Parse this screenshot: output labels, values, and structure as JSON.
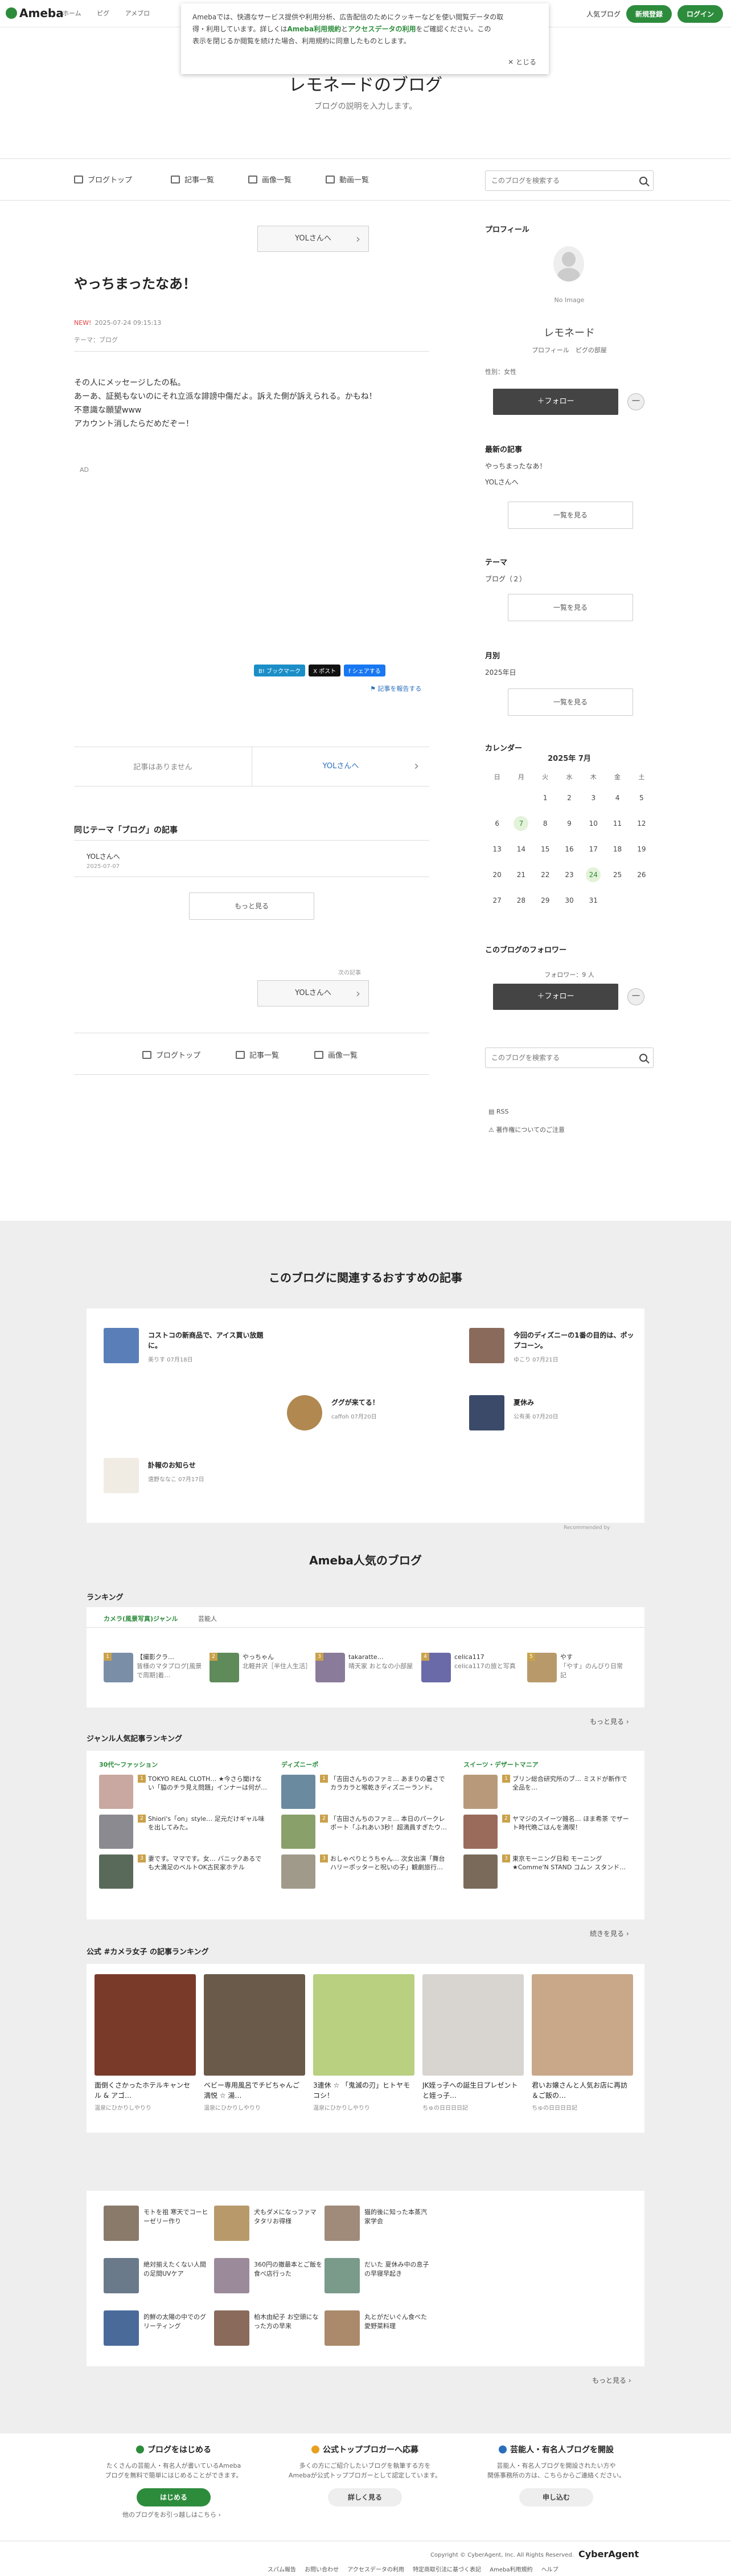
{
  "header": {
    "logo": "Ameba",
    "crumbs": [
      "ホーム",
      "ピグ",
      "アメブロ"
    ],
    "popular": "人気ブログ",
    "signup": "新規登録",
    "login": "ログイン"
  },
  "cookie": {
    "line1": "Amebaでは、快適なサービス提供や利用分析、広告配信のためにクッキーなどを使い閲覧データの取",
    "line2a": "得・利用しています。詳しくは",
    "terms": "Ameba利用規約",
    "and": "と",
    "policy": "アクセスデータの利用",
    "line2b": "をご確認ください。この",
    "line3": "表示を閉じるか閲覧を続けた場合、利用規約に同意したものとします。",
    "close": "とじる"
  },
  "blog": {
    "title": "レモネードのブログ",
    "description": "ブログの説明を入力します。"
  },
  "nav": {
    "top": "ブログトップ",
    "entries": "記事一覧",
    "images": "画像一覧",
    "videos": "動画一覧",
    "search_placeholder": "このブログを検索する"
  },
  "entry": {
    "next_label": "YOLさんへ",
    "title": "やっちまったなあ！",
    "new_badge": "NEW!",
    "datetime": "2025-07-24 09:15:13",
    "theme": "テーマ：ブログ",
    "body": [
      "その人にメッセージしたの私。",
      "あーあ、証拠もないのにそれ立派な誹謗中傷だよ。訴えた側が訴えられる。かもね！",
      "不意識な願望www",
      "アカウント消したらだめだぞー！"
    ],
    "ad": "AD",
    "share": {
      "hatena": "B! ブックマーク",
      "x": "X ポスト",
      "facebook": "f シェアする"
    },
    "report": "記事を報告する",
    "prev_none": "記事はありません",
    "next_title": "YOLさんへ",
    "same_theme_heading": "同じテーマ「ブログ」の記事",
    "same_item_title": "YOLさんへ",
    "same_item_date": "2025-07-07",
    "more": "もっと見る",
    "prev_label": "次の記事",
    "prev_button": "YOLさんへ"
  },
  "sidebar": {
    "profile_heading": "プロフィール",
    "noimage": "No Image",
    "name": "レモネード",
    "link_profile": "プロフィール",
    "link_room": "ピグの部屋",
    "gender": "性別：女性",
    "follow": "＋フォロー",
    "minus": "ー",
    "recent_heading": "最新の記事",
    "recent": [
      "やっちまったなあ！",
      "YOLさんへ"
    ],
    "recent_more": "一覧を見る",
    "theme_heading": "テーマ",
    "theme_item": "ブログ（２）",
    "theme_more": "一覧を見る",
    "monthly_heading": "月別",
    "monthly_item": "2025年日",
    "monthly_more": "一覧を見る",
    "calendar_heading": "カレンダー",
    "calendar_title": "2025年 7月",
    "weekdays": [
      "日",
      "月",
      "火",
      "水",
      "木",
      "金",
      "土"
    ],
    "weeks": [
      [
        "",
        "",
        "1",
        "2",
        "3",
        "4",
        "5"
      ],
      [
        "6",
        "7",
        "8",
        "9",
        "10",
        "11",
        "12"
      ],
      [
        "13",
        "14",
        "15",
        "16",
        "17",
        "18",
        "19"
      ],
      [
        "20",
        "21",
        "22",
        "23",
        "24",
        "25",
        "26"
      ],
      [
        "27",
        "28",
        "29",
        "30",
        "31",
        "",
        ""
      ]
    ],
    "follower_heading": "このブログのフォロワー",
    "follower_count": "フォロワー：9 人",
    "follow2": "＋フォロー",
    "search_placeholder": "このブログを検索する",
    "rss": "RSS",
    "copyright_note": "著作権についてのご注意"
  },
  "recommend": {
    "heading": "このブログに関連するおすすめの記事",
    "items": [
      {
        "title": "コストコの新商品で、アイス買い放題に。",
        "meta": "美りす 07月18日"
      },
      {
        "title": "今回のディズニーの1番の目的は、ポップコーン。",
        "meta": "ゆこり 07月21日"
      },
      {
        "title": "ググが来てる！",
        "meta": "caffoh 07月20日"
      },
      {
        "title": "夏休み",
        "meta": "公有美 07月20日"
      },
      {
        "title": "訃報のお知らせ",
        "meta": "遠野ななこ 07月17日"
      }
    ],
    "by": "Recommended by"
  },
  "popular": {
    "heading": "Ameba人気のブログ",
    "ranking_heading": "ランキング",
    "tabs": [
      "カメラ(風景写真)ジャンル",
      "芸能人"
    ],
    "ranking": [
      {
        "n": "1",
        "title": "【撮影クラ…",
        "sub": "皆様のマタプログ[風景で周期]着…"
      },
      {
        "n": "2",
        "title": "やっちゃん",
        "sub": "北軽井沢［半住人生活］"
      },
      {
        "n": "3",
        "title": "takaratte…",
        "sub": "晴天家 おとなの小部屋"
      },
      {
        "n": "4",
        "title": "celica117",
        "sub": "celica117の旅と写真"
      },
      {
        "n": "5",
        "title": "やす",
        "sub": "「やす」のんびり日常記"
      }
    ],
    "ranking_more": "もっと見る",
    "genre_heading": "ジャンル人気記事ランキング",
    "genres": [
      {
        "name": "30代〜ファッション",
        "items": [
          {
            "n": "1",
            "title": "TOKYO REAL CLOTH… ★今さら聞けない「脇のチラ見え問題」インナーは何が…"
          },
          {
            "n": "2",
            "title": "Shiori's「on」style… 足元だけギャル味を出してみた。"
          },
          {
            "n": "3",
            "title": "妻です。ママです。女… バニックあるでも大満足のベルトOK古民家ホテル"
          }
        ]
      },
      {
        "name": "ディズニーポ",
        "items": [
          {
            "n": "1",
            "title": "「吉田さんちのファミ… あまりの暑さでカラカラと喉乾きディズニーランド。"
          },
          {
            "n": "2",
            "title": "「吉田さんちのファミ… 本日のパークレポート「ふれあい3秒！超満員すぎたウ…"
          },
          {
            "n": "3",
            "title": "おしゃべりとうちゃん… 次女出演「舞台 ハリーポッターと呪いの子」観劇旅行…"
          }
        ]
      },
      {
        "name": "スイーツ・デザートマニア",
        "items": [
          {
            "n": "1",
            "title": "ブリン総合研究所のブ… ミスドが新作で全品を…"
          },
          {
            "n": "2",
            "title": "ヤマジのスイーツ雑名… ほま希茶 でザート時代晩ごはんを満喫！"
          },
          {
            "n": "3",
            "title": "東京モーニング日和 モーニング★Comme'N STAND コムン スタンド…"
          }
        ]
      }
    ],
    "genre_more": "続きを見る",
    "photo_heading": "公式 #カメラ女子 の記事ランキング",
    "photos": [
      {
        "n": "1",
        "title": "面倒くさかったホテルキャンセル & アゴ…",
        "au": "温泉にひかりしやりり"
      },
      {
        "n": "2",
        "title": "ベビー専用風呂でチビちゃんご満悦 ☆ 湯…",
        "au": "温泉にひかりしやりり"
      },
      {
        "n": "3",
        "title": "3連休 ☆ 「鬼滅の刃」ヒトヤモコシ！",
        "au": "温泉にひかりしやりり"
      },
      {
        "n": "4",
        "title": "JK姪っ子への誕生日プレゼントと姪っ子…",
        "au": "ちゅの日日日日記"
      },
      {
        "n": "5",
        "title": "君いお嬢さんと人気お店に再訪＆ご飯の…",
        "au": "ちゅの日日日日記"
      }
    ],
    "photo_ad": "PR",
    "small": [
      {
        "title": "モトを祖 寒天でコーヒーゼリー作り"
      },
      {
        "title": "犬もダメになっファマタタリお得様"
      },
      {
        "title": "猫的後に知った本蒸汽家学会"
      },
      {
        "title": "絶対揃えたくない人間の足間UVケア"
      },
      {
        "title": "360円の撤最本とご飯を食べ店行った"
      },
      {
        "title": "だいた 夏休み中の息子の早寝早起き"
      },
      {
        "title": "的鮮の太陽の中でのグリーティング"
      },
      {
        "title": "柏木由紀子 お空頭になった方の早来"
      },
      {
        "title": "丸とがだいぐん食べた愛野菜料理"
      }
    ],
    "small_more": "もっと見る"
  },
  "footer": {
    "cols": [
      {
        "h": "ブログをはじめる",
        "d1": "たくさんの芸能人・有名人が書いているAmeba",
        "d2": "ブログを無料で簡単にはじめることができます。",
        "b": "はじめる"
      },
      {
        "h": "公式トップブロガーへ応募",
        "d1": "多くの方にご紹介したいブログを執筆する方を",
        "d2": "Amebaが公式トップブロガーとして認定しています。",
        "b": "詳しく見る"
      },
      {
        "h": "芸能人・有名人ブログを開設",
        "d1": "芸能人・有名人ブログを開設されたい方や",
        "d2": "関係事務所の方は、こちらからご連絡ください。",
        "b": "申し込む"
      }
    ],
    "sub": "他のブログをお引っ越しはこちら ›",
    "copyright": "Copyright © CyberAgent, Inc. All Rights Reserved.",
    "ca": "CyberAgent",
    "links": [
      "スパム報告",
      "お問い合わせ",
      "アクセスデータの利用",
      "特定商取引法に基づく表記",
      "Ameba利用規約",
      "ヘルプ"
    ]
  },
  "colors": {
    "brand": "#2d8c3c",
    "link": "#2a6ebb",
    "gray_bg": "#eeeeee"
  }
}
